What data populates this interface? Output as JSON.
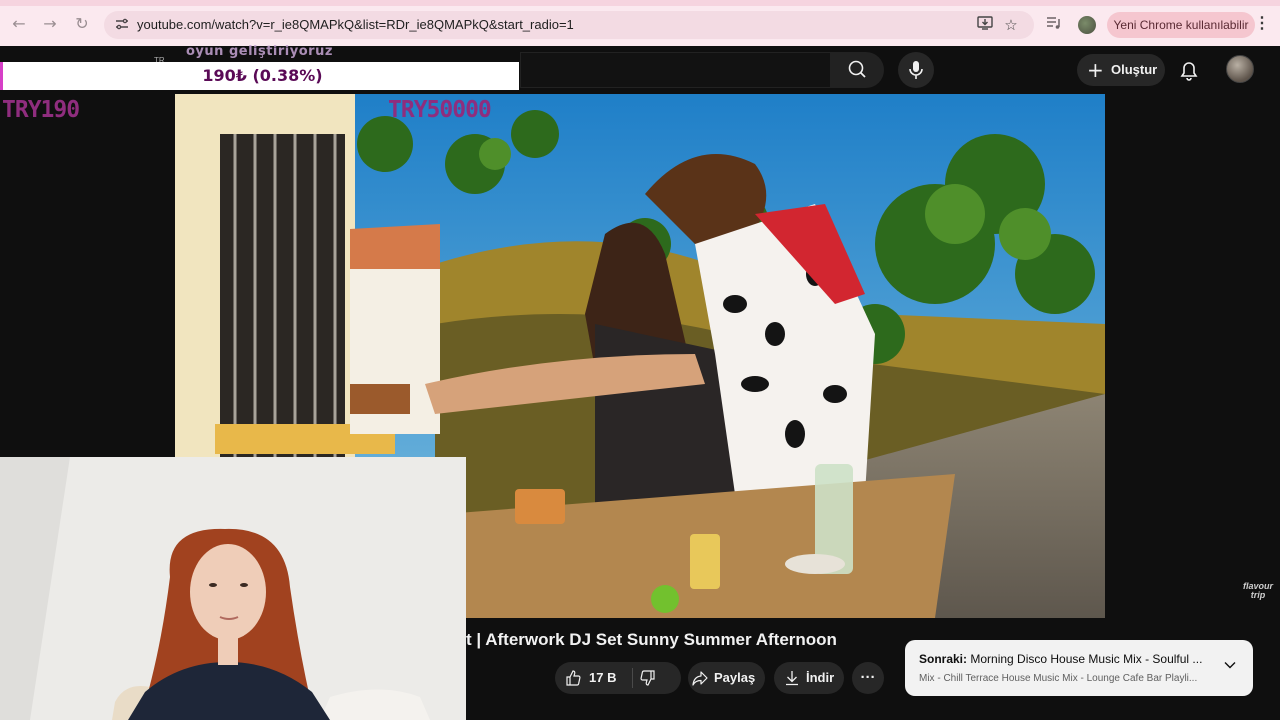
{
  "browser": {
    "url": "youtube.com/watch?v=r_ie8QMAPkQ&list=RDr_ie8QMAPkQ&start_radio=1",
    "update_pill": "Yeni Chrome kullanılabilir",
    "icons": {
      "back": "arrow-left-icon",
      "forward": "arrow-right-icon",
      "reload": "reload-icon",
      "site_info": "tune-icon",
      "install": "install-app-icon",
      "bookmark": "star-icon",
      "extension": "media-control-icon",
      "menu": "kebab-menu-icon"
    }
  },
  "youtube_header": {
    "create_label": "Oluştur",
    "icons": {
      "search": "search-icon",
      "voice": "mic-icon",
      "notifications": "bell-icon"
    }
  },
  "overlay": {
    "progress_text": "190₺ (0.38%)",
    "progress_fraction": 0.0038,
    "ghost_text": "oyun geliştiriyoruz",
    "tag": "TR",
    "current_amount": "TRY190",
    "goal_amount": "TRY50000",
    "accent_color": "#8f2d7e"
  },
  "video": {
    "title_fragment": "t | Afterwork DJ Set Sunny Summer Afternoon",
    "watermark": "flavour trip",
    "like_count": "17 B",
    "share_label": "Paylaş",
    "download_label": "İndir",
    "more_label": "···"
  },
  "up_next": {
    "prefix": "Sonraki:",
    "title": "Morning Disco House Music Mix - Soulful ...",
    "subtitle": "Mix - Chill Terrace House Music Mix - Lounge Cafe Bar Playli..."
  }
}
